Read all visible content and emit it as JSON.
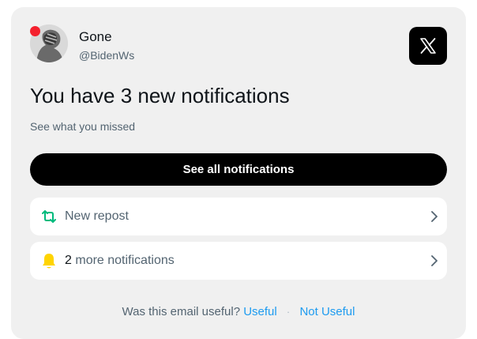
{
  "user": {
    "name": "Gone",
    "handle": "@BidenWs",
    "avatar": "user-avatar-icon"
  },
  "brand": {
    "logo": "x-logo-icon",
    "color": "#000000"
  },
  "headline": "You have 3 new notifications",
  "subtitle": "See what you missed",
  "cta": {
    "label": "See all notifications"
  },
  "notifications": [
    {
      "icon": "repost-icon",
      "count": "",
      "label": "New repost",
      "icon_color": "#00ba7c"
    },
    {
      "icon": "bell-icon",
      "count": "2",
      "label": "more notifications",
      "icon_color": "#ffd400"
    }
  ],
  "feedback": {
    "question": "Was this email useful?",
    "yes": "Useful",
    "separator": "·",
    "no": "Not Useful"
  },
  "colors": {
    "alert_dot": "#f4212e",
    "link": "#1d9bf0",
    "card_bg": "#f0f0f0"
  }
}
